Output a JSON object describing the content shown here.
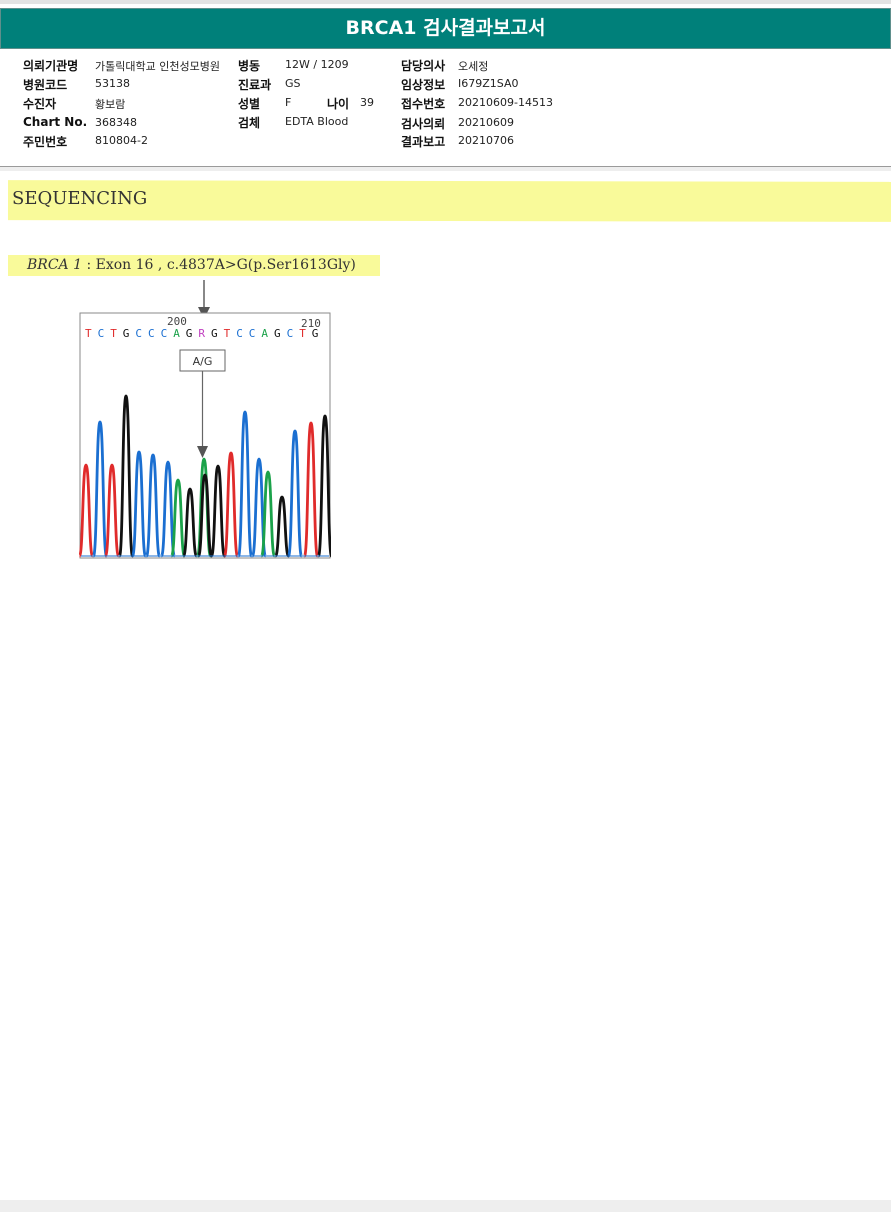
{
  "header": {
    "title": "BRCA1 검사결과보고서"
  },
  "info": {
    "col1": [
      {
        "label": "의뢰기관명",
        "value": "가톨릭대학교 인천성모병원"
      },
      {
        "label": "병원코드",
        "value": "53138"
      },
      {
        "label": "수진자",
        "value": "황보람"
      },
      {
        "label": "Chart No.",
        "value": "368348"
      },
      {
        "label": "주민번호",
        "value": "810804-2"
      }
    ],
    "col2": [
      {
        "label": "병동",
        "value": "12W / 1209"
      },
      {
        "label": "진료과",
        "value": "GS"
      },
      {
        "label": "성별",
        "value": "F"
      },
      {
        "label": "검체",
        "value": "EDTA Blood"
      }
    ],
    "age": {
      "label": "나이",
      "value": "39"
    },
    "col3": [
      {
        "label": "담당의사",
        "value": "오세정"
      },
      {
        "label": "임상정보",
        "value": "I679Z1SA0"
      },
      {
        "label": "접수번호",
        "value": "20210609-14513"
      },
      {
        "label": "검사의뢰",
        "value": "20210609"
      },
      {
        "label": "결과보고",
        "value": "20210706"
      }
    ]
  },
  "section": {
    "title": "SEQUENCING"
  },
  "mutation": {
    "gene": "BRCA 1",
    "sep": " : ",
    "detail": "Exon 16 , c.4837A>G(p.Ser1613Gly)"
  },
  "chromatogram": {
    "pos_label_1": "200",
    "pos_label_2": "210",
    "sequence": [
      "T",
      "C",
      "T",
      "G",
      "C",
      "C",
      "C",
      "A",
      "G",
      "R",
      "G",
      "T",
      "C",
      "C",
      "A",
      "G",
      "C",
      "T",
      "G"
    ],
    "call_label": "A/G",
    "base_colors": {
      "A": "#1ba24a",
      "C": "#1b6fd1",
      "G": "#111111",
      "T": "#e02b2b",
      "R": "#c040c0"
    }
  }
}
